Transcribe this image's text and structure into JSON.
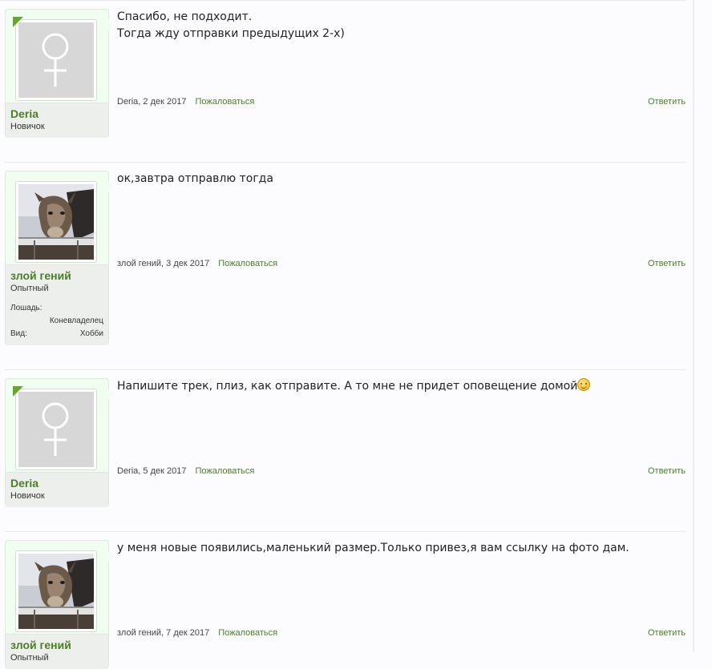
{
  "posts": [
    {
      "username": "Deria",
      "user_title": "Новичок",
      "avatar": "female-default-avatar",
      "message_lines": [
        "Спасибо, не подходит.",
        "Тогда жду отправки предыдущих 2-х)"
      ],
      "author_date": "Deria, 2 дек 2017",
      "report_label": "Пожаловаться",
      "reply_label": "Ответить"
    },
    {
      "username": "злой гений",
      "user_title": "Опытный",
      "avatar": "horse-photo-avatar",
      "extra_fields": [
        {
          "label": "Лошадь:",
          "value": "Коневладелец"
        },
        {
          "label": "Вид:",
          "value": "Хобби"
        }
      ],
      "message_lines": [
        "ок,завтра отправлю тогда"
      ],
      "author_date": "злой гений, 3 дек 2017",
      "report_label": "Пожаловаться",
      "reply_label": "Ответить"
    },
    {
      "username": "Deria",
      "user_title": "Новичок",
      "avatar": "female-default-avatar",
      "message_lines": [
        "Напишите трек, плиз, как отправите. А то мне не придет оповещение домой"
      ],
      "smiley": "smile-icon",
      "author_date": "Deria, 5 дек 2017",
      "report_label": "Пожаловаться",
      "reply_label": "Ответить"
    },
    {
      "username": "злой гений",
      "user_title": "Опытный",
      "avatar": "horse-photo-avatar",
      "message_lines": [
        "у меня новые появились,маленький размер.Только привез,я вам ссылку на фото дам."
      ],
      "author_date": "злой гений, 7 дек 2017",
      "report_label": "Пожаловаться",
      "reply_label": "Ответить"
    }
  ],
  "colors": {
    "accent_green": "#4a7f26",
    "user_block_bg": "#f0fdf0",
    "corner_badge": "#67a52b"
  }
}
